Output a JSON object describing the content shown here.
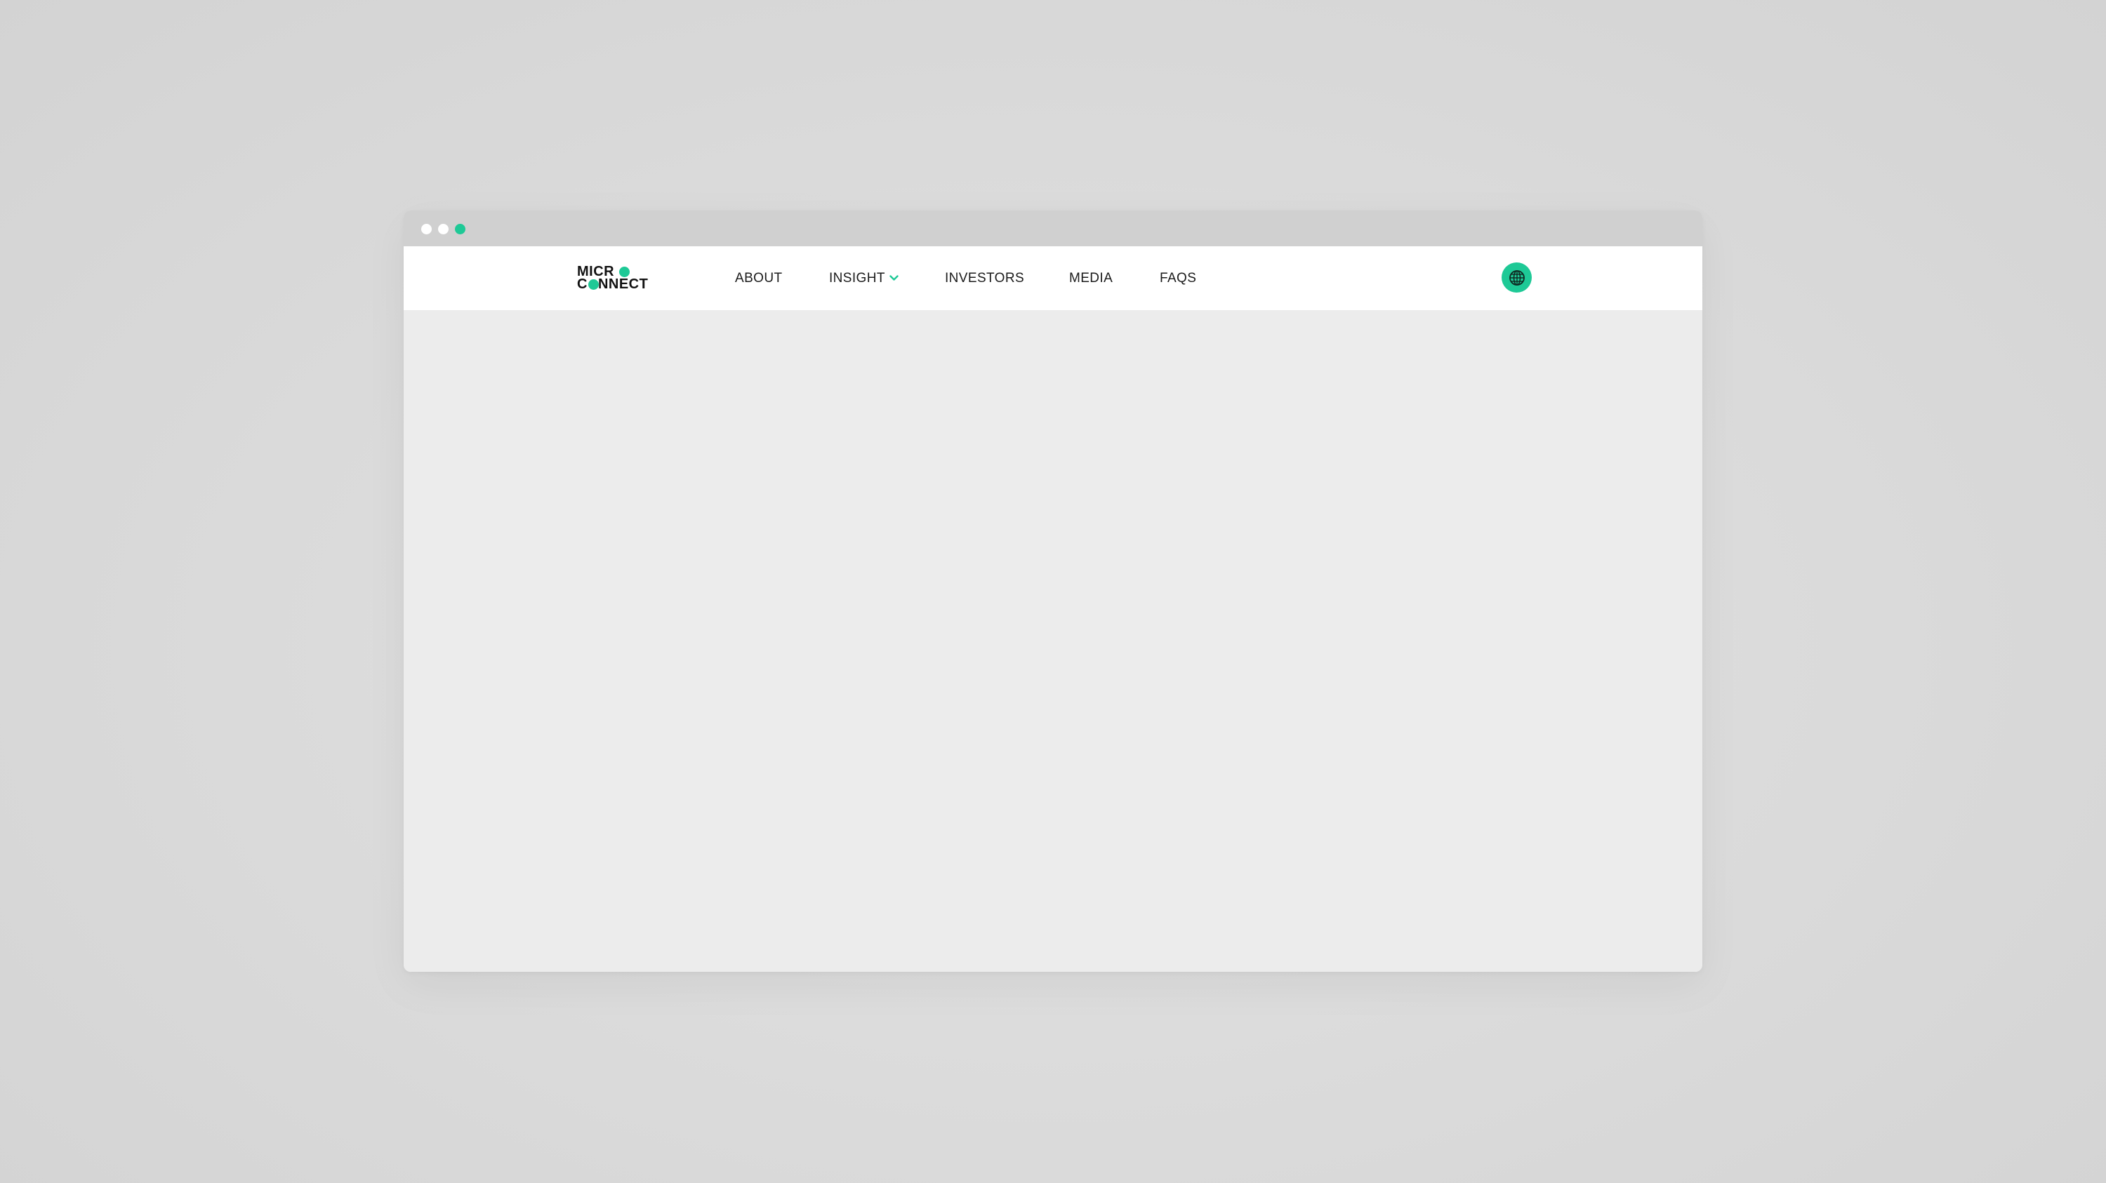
{
  "window": {
    "traffic_lights": [
      "#ffffff",
      "#ffffff",
      "#1ec996"
    ]
  },
  "brand": {
    "logo_line_1": "MICR",
    "logo_line_2_prefix": "C",
    "logo_line_2_suffix": "NNECT",
    "accent_color": "#1ec996",
    "logo_icon": "micro-connect-logo"
  },
  "nav": {
    "items": [
      {
        "label": "ABOUT",
        "has_dropdown": false
      },
      {
        "label": "INSIGHT",
        "has_dropdown": true,
        "icon": "chevron-down-icon"
      },
      {
        "label": "INVESTORS",
        "has_dropdown": false
      },
      {
        "label": "MEDIA",
        "has_dropdown": false
      },
      {
        "label": "FAQS",
        "has_dropdown": false
      }
    ]
  },
  "header_actions": {
    "language_icon": "globe-icon",
    "language_button_color": "#1ec996"
  }
}
